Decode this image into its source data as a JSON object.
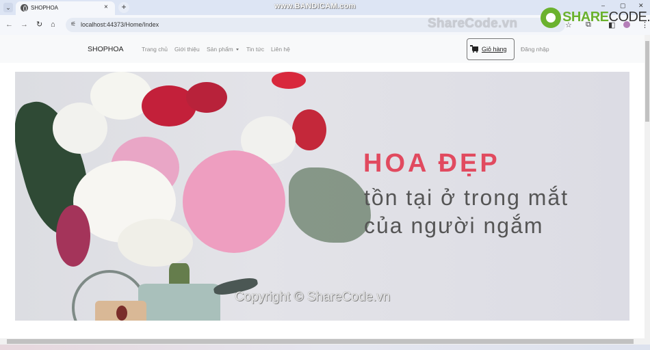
{
  "browser": {
    "tab_title": "SHOPHOA",
    "new_tab_label": "+",
    "tab_close": "×",
    "tab_menu": "⌄",
    "url": "localhost:44373/Home/Index",
    "back": "←",
    "forward": "→",
    "reload": "↻",
    "home": "⌂",
    "site_info": "⚟",
    "star": "☆",
    "window": {
      "minimize": "–",
      "maximize": "▢",
      "close": "✕"
    },
    "toolbar_icons": {
      "extensions": "⧉",
      "sidebar": "◧",
      "menu": "⋮"
    }
  },
  "watermarks": {
    "recorder": "www.BANDICAM.com",
    "address_overlay": "ShareCode.vn",
    "logo_main": "SHARE",
    "logo_rest": "CODE.vn",
    "copyright": "Copyright © ShareCode.vn"
  },
  "navbar": {
    "brand": "SHOPHOA",
    "links": [
      {
        "label": "Trang chủ"
      },
      {
        "label": "Giới thiệu"
      },
      {
        "label": "Sản phẩm",
        "dropdown": true
      },
      {
        "label": "Tin tức"
      },
      {
        "label": "Liên hệ"
      }
    ],
    "cart_label": "Giỏ hàng",
    "login_label": "Đăng nhập"
  },
  "banner": {
    "headline": "HOA ĐẸP",
    "line1": "tồn tại ở trong mắt",
    "line2": "của người ngắm",
    "image_subject": "flower bouquet in watering can",
    "accent_color": "#e14a5f"
  }
}
